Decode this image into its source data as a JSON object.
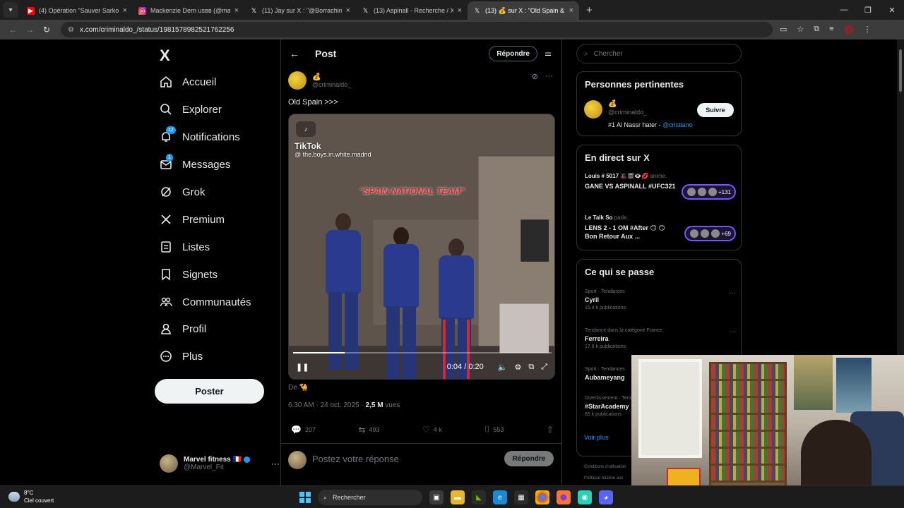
{
  "browser": {
    "tabs": [
      {
        "title": "(4) Opération \"Sauver Sarko\", la",
        "favicon": "youtube",
        "color": "#ff0000",
        "active": false
      },
      {
        "title": "Mackenzie Dern usвв (@macke",
        "favicon": "instagram",
        "color": "#d62976",
        "active": false
      },
      {
        "title": "(11) Jay sur X : \"@Borrachinhal",
        "favicon": "x",
        "color": "#000000",
        "active": false
      },
      {
        "title": "(13) Aspinall - Recherche / X",
        "favicon": "x",
        "color": "#000000",
        "active": false
      },
      {
        "title": "(13) 💰 sur X : \"Old Spain &",
        "favicon": "x",
        "color": "#000000",
        "active": true
      }
    ],
    "new_tab": "+",
    "url": "x.com/criminaldo_/status/1981578982521762256"
  },
  "nav": {
    "logo": "X",
    "items": [
      {
        "label": "Accueil",
        "icon": "home-icon",
        "badge": ""
      },
      {
        "label": "Explorer",
        "icon": "search-icon",
        "badge": ""
      },
      {
        "label": "Notifications",
        "icon": "bell-icon",
        "badge": "12"
      },
      {
        "label": "Messages",
        "icon": "mail-icon",
        "badge": "1"
      },
      {
        "label": "Grok",
        "icon": "grok-icon",
        "badge": ""
      },
      {
        "label": "Premium",
        "icon": "x-premium-icon",
        "badge": ""
      },
      {
        "label": "Listes",
        "icon": "list-icon",
        "badge": ""
      },
      {
        "label": "Signets",
        "icon": "bookmark-icon",
        "badge": ""
      },
      {
        "label": "Communautés",
        "icon": "communities-icon",
        "badge": ""
      },
      {
        "label": "Profil",
        "icon": "profile-icon",
        "badge": ""
      },
      {
        "label": "Plus",
        "icon": "more-circle-icon",
        "badge": ""
      }
    ],
    "post_button": "Poster",
    "account": {
      "name": "Marvel fitness 🇫🇷",
      "handle": "@Marvel_Fit"
    }
  },
  "main": {
    "title": "Post",
    "reply_top": "Répondre",
    "author": {
      "name": "💰",
      "handle": "@criminaldo_"
    },
    "text": "Old Spain >>>",
    "video": {
      "tiktok_label": "TikTok",
      "tiktok_user": "@ the.boys.in.white.madrid",
      "caption": "\"SPAIN NATIONAL TEAM\"",
      "time": "0:04 / 0:20",
      "progress": 0.2
    },
    "source": "De 🐪",
    "time": "6:30 AM · 24 oct. 2025 · ",
    "views_count": "2,5 M",
    "views_label": " vues",
    "stats": {
      "replies": "207",
      "reposts": "493",
      "likes": "4 k",
      "bookmarks": "553"
    },
    "reply_placeholder": "Postez votre réponse",
    "reply_button": "Répondre"
  },
  "right": {
    "search_placeholder": "Chercher",
    "relevant": {
      "title": "Personnes pertinentes",
      "name": "💰",
      "handle": "@criminaldo_",
      "bio": "#1 Al Nassr hater - ",
      "bio_link": "@cristiano",
      "follow": "Suivre"
    },
    "live": {
      "title": "En direct sur X",
      "items": [
        {
          "host": "Louis # 5017 🎩🎬👁️💋",
          "action": " anime.",
          "title": "GANE VS ASPINALL #UFC321",
          "count": "+131"
        },
        {
          "host": "Le Talk So",
          "action": " parle.",
          "title": "LENS 2 - 1 OM #After 😏 😏 Bon Retour Aux ...",
          "count": "+69"
        }
      ]
    },
    "trends": {
      "title": "Ce qui se passe",
      "items": [
        {
          "category": "Sport · Tendances",
          "name": "Cyril",
          "count": "15,4 k publications"
        },
        {
          "category": "Tendance dans la catégorie France",
          "name": "Ferreira",
          "count": "17,8 k publications"
        },
        {
          "category": "Sport · Tendances",
          "name": "Aubameyang",
          "count": ""
        },
        {
          "category": "Divertissement · Tendances",
          "name": "#StarAcademy",
          "count": "65 k publications"
        }
      ],
      "more": "Voir plus"
    },
    "footer": [
      "Conditions d'utilisation",
      "Politique relative aux"
    ]
  },
  "taskbar": {
    "weather_temp": "8°C",
    "weather_desc": "Ciel couvert",
    "search": "Rechercher"
  }
}
